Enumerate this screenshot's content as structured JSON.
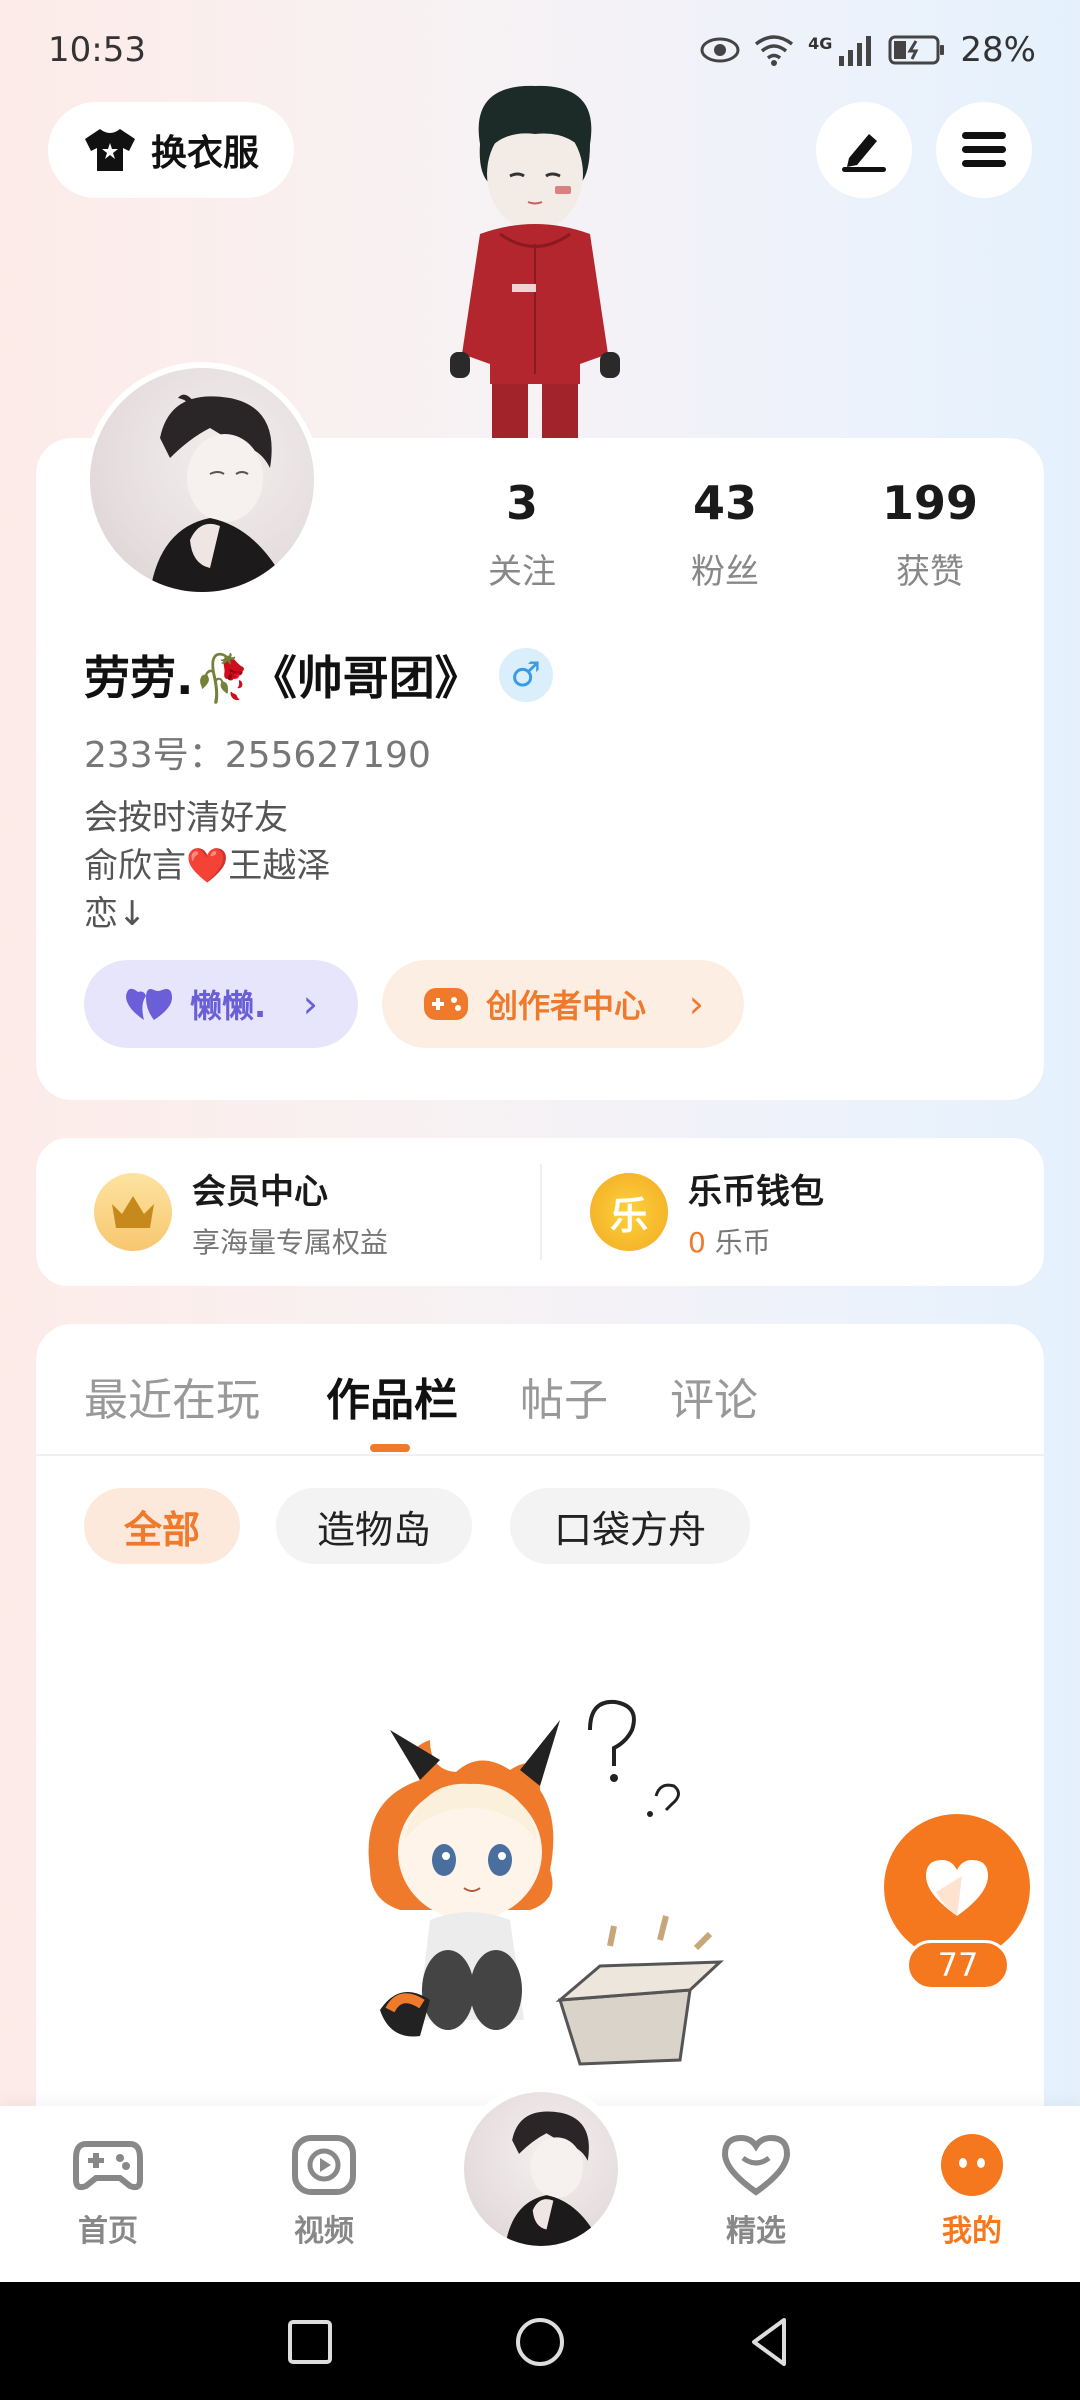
{
  "status_bar": {
    "time": "10:53",
    "network": "4G",
    "battery": "28%"
  },
  "header": {
    "outfit_button": "换衣服"
  },
  "profile": {
    "stats": [
      {
        "value": "3",
        "label": "关注"
      },
      {
        "value": "43",
        "label": "粉丝"
      },
      {
        "value": "199",
        "label": "获赞"
      }
    ],
    "name": "劳劳.🥀《帅哥团》",
    "gender": "♂",
    "id_line": "233号：255627190",
    "bio": [
      "会按时清好友",
      "俞欣言❤️王越泽",
      "恋↓"
    ],
    "fan_group_label": "懒懒.",
    "creator_label": "创作者中心"
  },
  "vip": {
    "member_title": "会员中心",
    "member_sub": "享海量专属权益",
    "wallet_title": "乐币钱包",
    "wallet_amount": "0",
    "wallet_unit": "乐币",
    "coin_glyph": "乐"
  },
  "tabs": [
    "最近在玩",
    "作品栏",
    "帖子",
    "评论"
  ],
  "active_tab": "作品栏",
  "filters": [
    "全部",
    "造物岛",
    "口袋方舟"
  ],
  "favorite_count": "77",
  "bottom_nav": [
    {
      "label": "首页",
      "icon": "gamepad-icon"
    },
    {
      "label": "视频",
      "icon": "video-icon"
    },
    {
      "label": "精选",
      "icon": "heart-chat-icon"
    },
    {
      "label": "我的",
      "icon": "me-icon"
    }
  ],
  "colors": {
    "accent": "#f5781f",
    "fan_purple": "#6a5fd8",
    "gender_blue": "#3a9be6"
  }
}
